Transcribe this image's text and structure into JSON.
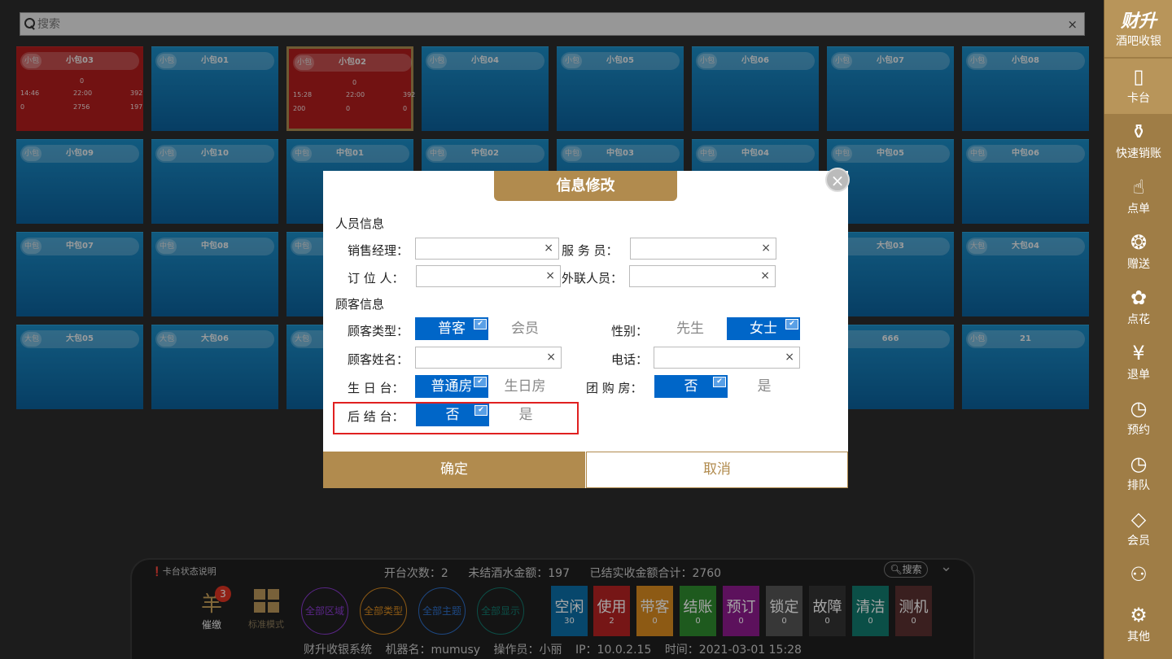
{
  "search": {
    "placeholder": "搜索",
    "clear": "×"
  },
  "rooms": [
    {
      "size": "小包",
      "name": "小包03",
      "state": "red",
      "vals": [
        "0",
        "14:46",
        "22:00",
        "392",
        "0",
        "2756",
        "197"
      ]
    },
    {
      "size": "小包",
      "name": "小包01",
      "state": "blue"
    },
    {
      "size": "小包",
      "name": "小包02",
      "state": "red",
      "vals": [
        "0",
        "15:28",
        "22:00",
        "392",
        "200",
        "0",
        "0"
      ]
    },
    {
      "size": "小包",
      "name": "小包04",
      "state": "blue"
    },
    {
      "size": "小包",
      "name": "小包05",
      "state": "blue"
    },
    {
      "size": "小包",
      "name": "小包06",
      "state": "blue"
    },
    {
      "size": "小包",
      "name": "小包07",
      "state": "blue"
    },
    {
      "size": "小包",
      "name": "小包08",
      "state": "blue"
    },
    {
      "size": "小包",
      "name": "小包09",
      "state": "blue"
    },
    {
      "size": "小包",
      "name": "小包10",
      "state": "blue"
    },
    {
      "size": "中包",
      "name": "中包01",
      "state": "blue"
    },
    {
      "size": "中包",
      "name": "中包02",
      "state": "blue"
    },
    {
      "size": "中包",
      "name": "中包03",
      "state": "blue"
    },
    {
      "size": "中包",
      "name": "中包04",
      "state": "blue"
    },
    {
      "size": "中包",
      "name": "中包05",
      "state": "blue"
    },
    {
      "size": "中包",
      "name": "中包06",
      "state": "blue"
    },
    {
      "size": "中包",
      "name": "中包07",
      "state": "blue"
    },
    {
      "size": "中包",
      "name": "中包08",
      "state": "blue"
    },
    {
      "size": "中包",
      "name": "",
      "state": "blue"
    },
    {
      "size": "",
      "name": "",
      "state": "blue"
    },
    {
      "size": "",
      "name": "",
      "state": "blue"
    },
    {
      "size": "",
      "name": "",
      "state": "blue"
    },
    {
      "size": "",
      "name": "大包03",
      "state": "blue"
    },
    {
      "size": "大包",
      "name": "大包04",
      "state": "blue"
    },
    {
      "size": "大包",
      "name": "大包05",
      "state": "blue"
    },
    {
      "size": "大包",
      "name": "大包06",
      "state": "blue"
    },
    {
      "size": "大包",
      "name": "",
      "state": "blue"
    },
    {
      "size": "",
      "name": "",
      "state": "blue"
    },
    {
      "size": "",
      "name": "",
      "state": "blue"
    },
    {
      "size": "",
      "name": "",
      "state": "blue"
    },
    {
      "size": "",
      "name": "666",
      "state": "blue"
    },
    {
      "size": "小包",
      "name": "21",
      "state": "blue"
    }
  ],
  "sidebar": {
    "brand": "财升",
    "brand_sub": "酒吧收银",
    "items": [
      {
        "label": "卡台",
        "icon": "door-icon"
      },
      {
        "label": "快速销账",
        "icon": "bottle-icon"
      },
      {
        "label": "点单",
        "icon": "hand-pointer-icon"
      },
      {
        "label": "赠送",
        "icon": "gift-icon"
      },
      {
        "label": "点花",
        "icon": "flower-icon"
      },
      {
        "label": "退单",
        "icon": "refund-icon"
      },
      {
        "label": "预约",
        "icon": "clock-icon"
      },
      {
        "label": "排队",
        "icon": "queue-clock-icon"
      },
      {
        "label": "会员",
        "icon": "diamond-icon"
      },
      {
        "label": "",
        "icon": "users-icon"
      },
      {
        "label": "其他",
        "icon": "gear-icon"
      }
    ]
  },
  "bottom": {
    "help": "卡台状态说明",
    "stats": [
      "开台次数：2",
      "未结酒水金额：197",
      "已结实收金额合计：2760"
    ],
    "search": "搜索",
    "remind": {
      "label": "催缴",
      "count": "3"
    },
    "mode": "标准模式",
    "filters": [
      "全部区域",
      "全部类型",
      "全部主题",
      "全部显示"
    ],
    "statuses": [
      {
        "label": "空闲",
        "count": "30",
        "color": "#0b6ea6"
      },
      {
        "label": "使用",
        "count": "2",
        "color": "#b52323"
      },
      {
        "label": "带客",
        "count": "0",
        "color": "#d98a1f"
      },
      {
        "label": "结账",
        "count": "0",
        "color": "#2f8a2f"
      },
      {
        "label": "预订",
        "count": "0",
        "color": "#8e1b8e"
      },
      {
        "label": "锁定",
        "count": "0",
        "color": "#555555"
      },
      {
        "label": "故障",
        "count": "0",
        "color": "#333333"
      },
      {
        "label": "清洁",
        "count": "0",
        "color": "#127a6e"
      },
      {
        "label": "测机",
        "count": "0",
        "color": "#5a3030"
      }
    ],
    "footer": [
      "财升收银系统",
      "机器名：mumusy",
      "操作员：小丽",
      "IP：10.0.2.15",
      "时间：2021-03-01 15:28"
    ]
  },
  "dialog": {
    "title": "信息修改",
    "staff_section": "人员信息",
    "sales_manager": "销售经理：",
    "waiter": "服 务 员：",
    "booker": "订 位 人：",
    "liaison": "外联人员：",
    "customer_section": "顾客信息",
    "customer_type": "顾客类型：",
    "type_opts": [
      "普客",
      "会员"
    ],
    "gender": "性别：",
    "gender_opts": [
      "先生",
      "女士"
    ],
    "customer_name": "顾客姓名：",
    "phone": "电话：",
    "birthday": "生 日 台：",
    "birthday_opts": [
      "普通房",
      "生日房"
    ],
    "group_buy": "团 购 房：",
    "group_opts": [
      "否",
      "是"
    ],
    "post_settle": "后 结 台：",
    "post_opts": [
      "否",
      "是"
    ],
    "confirm": "确定",
    "cancel": "取消",
    "clear": "×",
    "close": "×",
    "check": "✔"
  }
}
